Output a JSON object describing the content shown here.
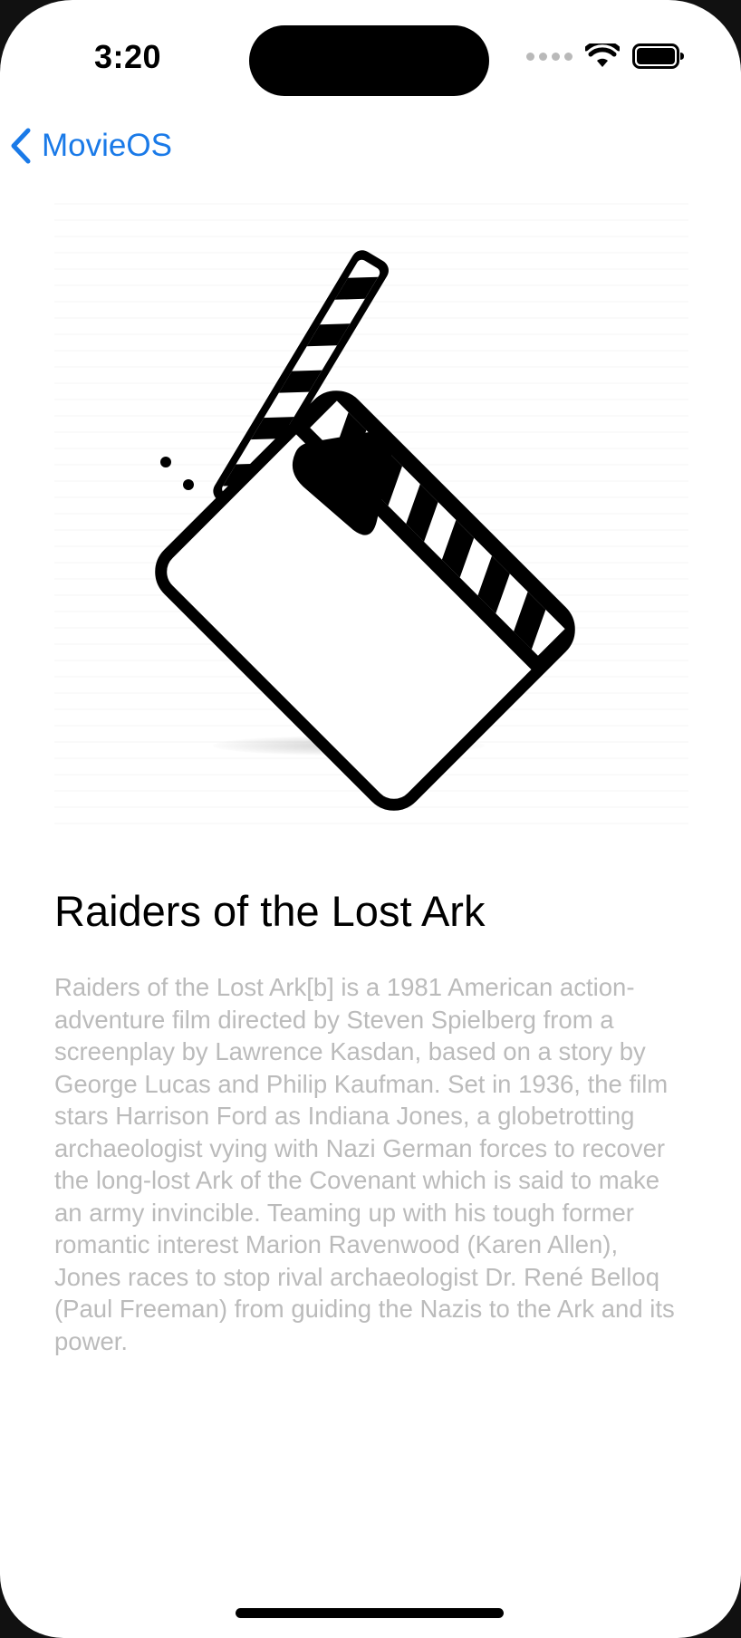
{
  "status_bar": {
    "time": "3:20",
    "wifi_icon": "wifi-icon",
    "battery_icon": "battery-icon",
    "signal_icon": "cellular-dots-icon"
  },
  "navigation": {
    "back_label": "MovieOS",
    "back_icon": "chevron-left-icon",
    "accent_color": "#1a7ae8"
  },
  "hero": {
    "icon": "clapperboard-play-icon"
  },
  "movie": {
    "title": "Raiders of the Lost Ark",
    "description": "Raiders of the Lost Ark[b] is a 1981 American action-adventure film directed by Steven Spielberg from a screenplay by Lawrence Kasdan, based on a story by George Lucas and Philip Kaufman. Set in 1936, the film stars Harrison Ford as Indiana Jones, a globetrotting archaeologist vying with Nazi German forces to recover the long-lost Ark of the Covenant which is said to make an army invincible. Teaming up with his tough former romantic interest Marion Ravenwood (Karen Allen), Jones races to stop rival archaeologist Dr. René Belloq (Paul Freeman) from guiding the Nazis to the Ark and its power.",
    "description_color": "#bbbbbb"
  }
}
